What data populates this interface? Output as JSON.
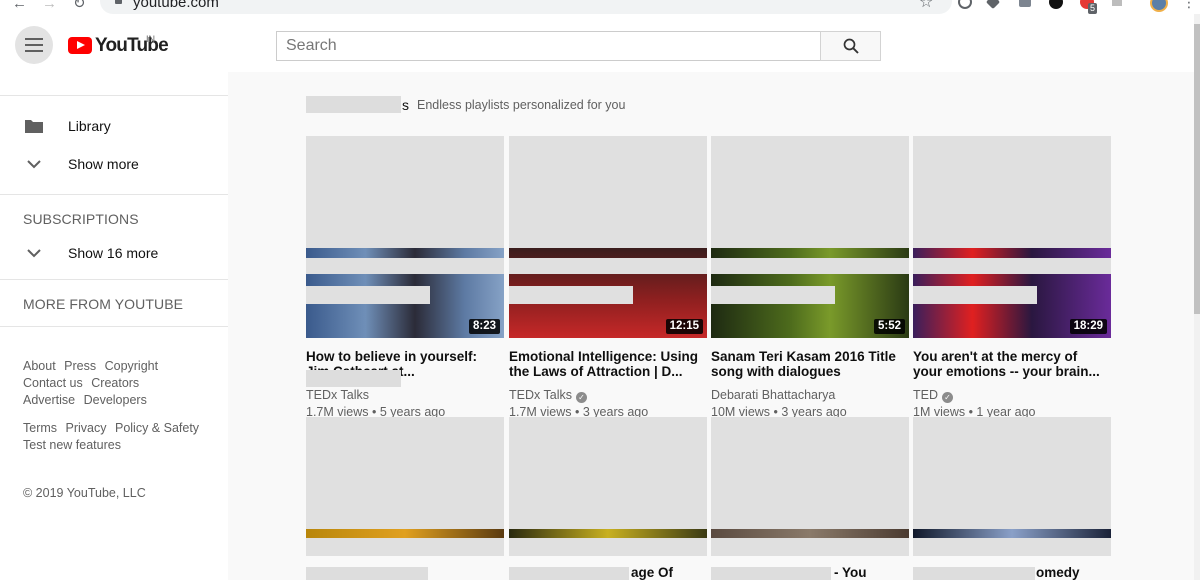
{
  "browser": {
    "url": "youtube.com",
    "extension_badge": "5"
  },
  "masthead": {
    "logo_text": "YouTube",
    "country_code": "IN",
    "search_placeholder": "Search"
  },
  "sidebar": {
    "library_label": "Library",
    "show_more_label": "Show more",
    "subscriptions_title": "SUBSCRIPTIONS",
    "show_subs_label": "Show 16 more",
    "more_from_title": "MORE FROM YOUTUBE",
    "footer_links_1": [
      "About",
      "Press",
      "Copyright"
    ],
    "footer_links_2": [
      "Contact us",
      "Creators"
    ],
    "footer_links_3": [
      "Advertise",
      "Developers"
    ],
    "footer_links_4": [
      "Terms",
      "Privacy",
      "Policy & Safety"
    ],
    "footer_links_5": [
      "Test new features"
    ],
    "copyright": "© 2019 YouTube, LLC"
  },
  "shelf": {
    "title_tail": "s",
    "subtitle": "Endless playlists personalized for you"
  },
  "videos": [
    {
      "title": "How to believe in yourself: Jim Cathcart at...",
      "channel": "TEDx Talks",
      "views": "1.7M views",
      "age": "5 years ago",
      "duration": "8:23",
      "verified": false
    },
    {
      "title": "Emotional Intelligence: Using the Laws of Attraction | D...",
      "channel": "TEDx Talks",
      "views": "1.7M views",
      "age": "3 years ago",
      "duration": "12:15",
      "verified": true
    },
    {
      "title": "Sanam Teri Kasam 2016 Title song with dialogues",
      "channel": "Debarati Bhattacharya",
      "views": "10M views",
      "age": "3 years ago",
      "duration": "5:52",
      "verified": false
    },
    {
      "title": "You aren't at the mercy of your emotions -- your brain...",
      "channel": "TED",
      "views": "1M views",
      "age": "1 year ago",
      "duration": "18:29",
      "verified": true
    }
  ],
  "videos_row2": [
    {
      "title_fragment": ""
    },
    {
      "title_fragment": "age Of"
    },
    {
      "title_fragment": "- You"
    },
    {
      "title_fragment": "omedy"
    }
  ],
  "colors": {
    "brand_red": "#ff0000",
    "placeholder_gray": "#e0e0e0",
    "secondary_text": "#606060"
  }
}
